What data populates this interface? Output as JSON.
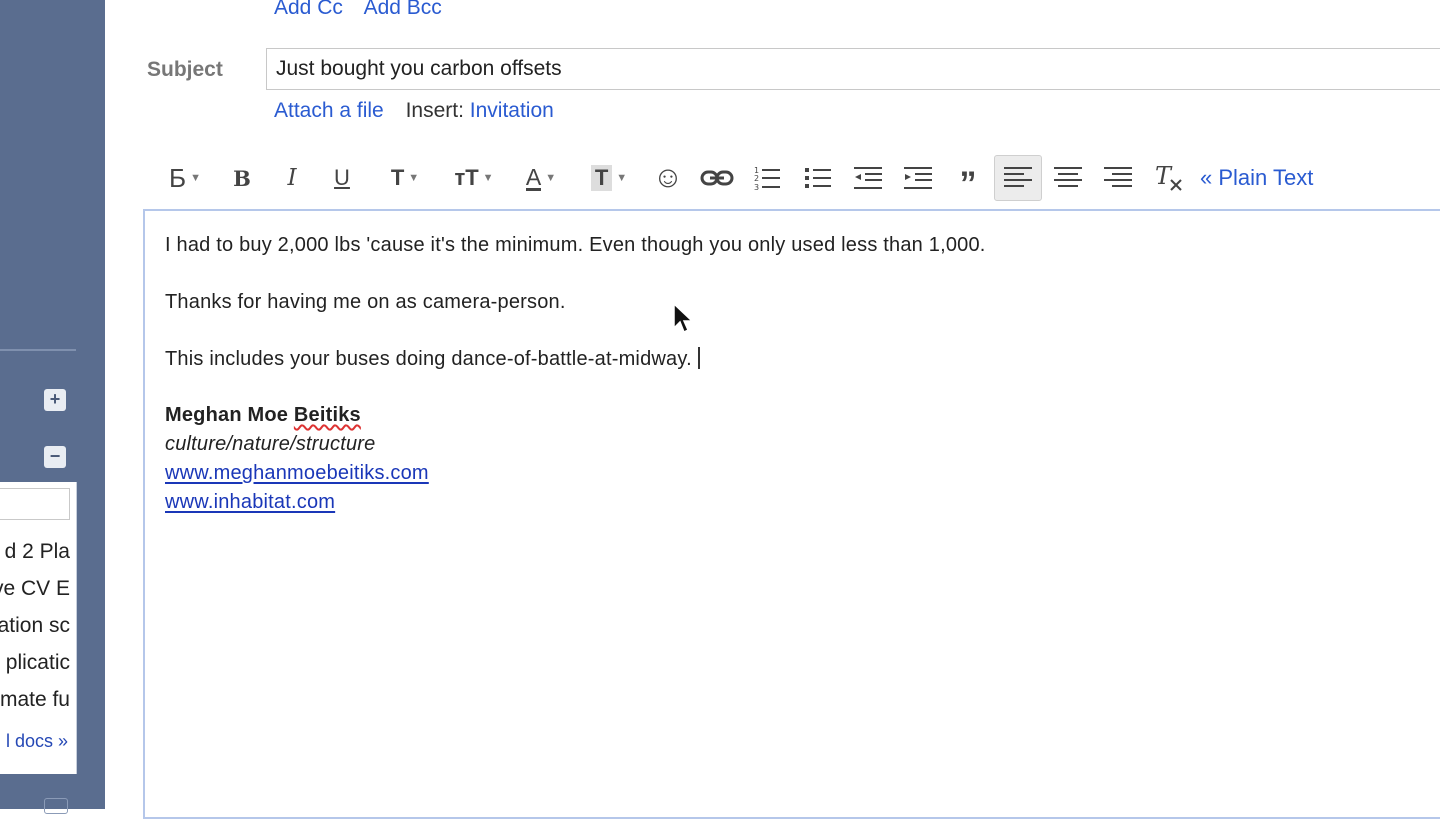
{
  "sidebar": {
    "docs": {
      "items": [
        "d 2 Pla",
        "ve CV E",
        "ation sc",
        "plicatic",
        "mate fu"
      ],
      "all_docs_link": "l docs »"
    },
    "expand_button": "+",
    "collapse_button": "−"
  },
  "compose": {
    "add_cc": "Add Cc",
    "add_bcc": "Add Bcc",
    "subject_label": "Subject",
    "subject_value": "Just bought you carbon offsets",
    "attach_file": "Attach a file",
    "insert_label": "Insert:",
    "insert_invitation": "Invitation"
  },
  "toolbar": {
    "font_glyph": "Б",
    "bold_glyph": "B",
    "italic_glyph": "I",
    "underline_glyph": "U",
    "font_size_glyph": "T",
    "text_size_glyph": "ᴛT",
    "text_color_glyph": "A",
    "highlight_glyph": "T",
    "smiley_glyph": "☺",
    "quote_glyph": "”",
    "plain_text_link": "« Plain Text",
    "active_tool": "align-left"
  },
  "body": {
    "paragraphs": [
      "I had to buy 2,000 lbs 'cause it's the minimum. Even though you only used less than 1,000.",
      "Thanks for having me on as camera-person.",
      "This includes your buses doing dance-of-battle-at-midway."
    ],
    "signature": {
      "name_first": "Meghan Moe ",
      "name_last": "Beitiks",
      "tagline": "culture/nature/structure",
      "link1": "www.meghanmoebeitiks.com",
      "link2": "www.inhabitat.com"
    }
  },
  "colors": {
    "sidebar": "#5a6d8f",
    "link": "#2a5bd1",
    "editor_border": "#b5c7ea"
  }
}
